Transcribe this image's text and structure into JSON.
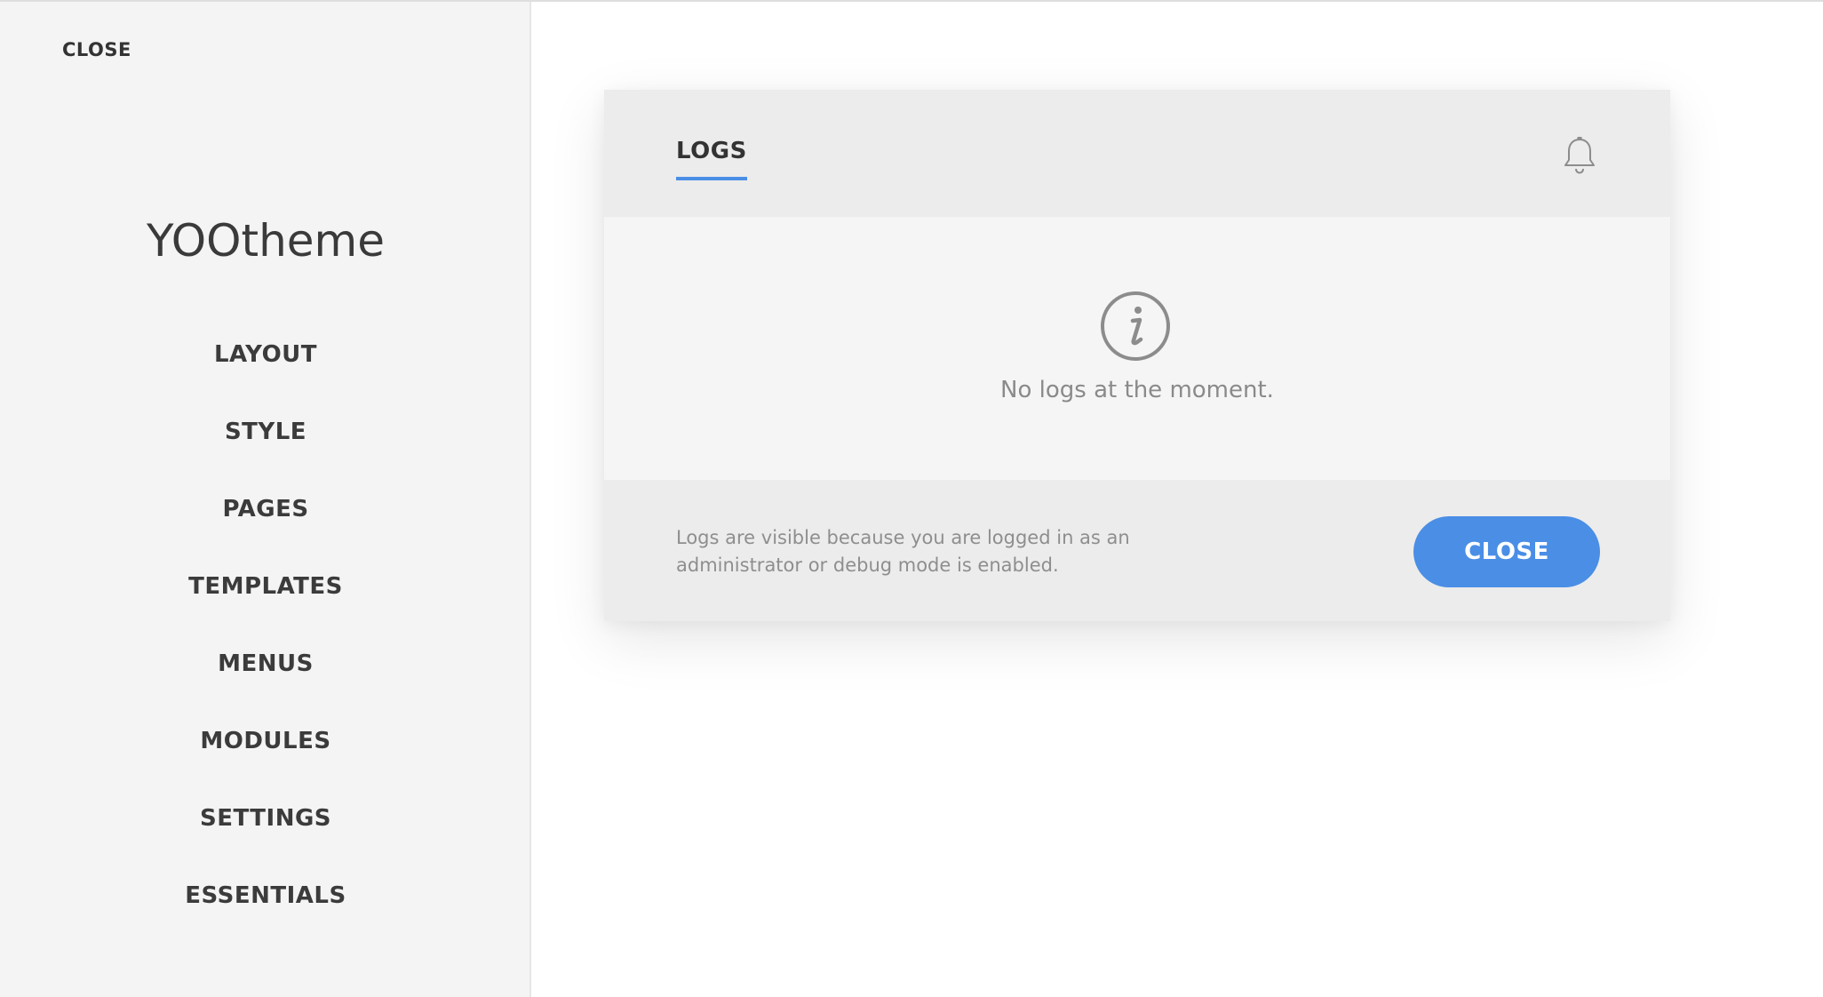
{
  "sidebar": {
    "close_label": "CLOSE",
    "title": "YOOtheme",
    "items": [
      {
        "label": "LAYOUT"
      },
      {
        "label": "STYLE"
      },
      {
        "label": "PAGES"
      },
      {
        "label": "TEMPLATES"
      },
      {
        "label": "MENUS"
      },
      {
        "label": "MODULES"
      },
      {
        "label": "SETTINGS"
      },
      {
        "label": "ESSENTIALS"
      }
    ]
  },
  "modal": {
    "tab_label": "LOGS",
    "header_icon": "bell-icon",
    "empty_icon": "info-icon",
    "empty_text": "No logs at the moment.",
    "footer_note": "Logs are visible because you are logged in as an administrator or debug mode is enabled.",
    "close_button_label": "CLOSE"
  },
  "colors": {
    "accent": "#4a8ee6",
    "sidebar_background": "#f4f4f4",
    "modal_header_background": "#ececec"
  }
}
